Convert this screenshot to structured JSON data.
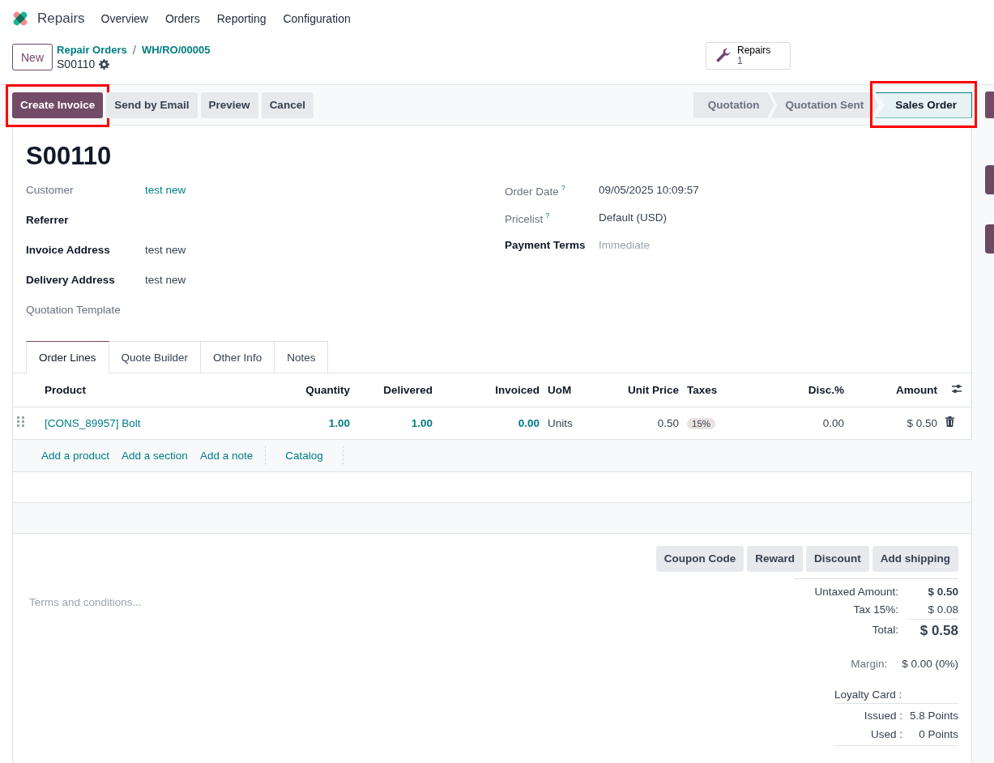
{
  "app": {
    "name": "Repairs",
    "menu": [
      "Overview",
      "Orders",
      "Reporting",
      "Configuration"
    ]
  },
  "control_panel": {
    "new_button": "New",
    "breadcrumbs": [
      "Repair Orders",
      "WH/RO/00005"
    ],
    "breadcrumb_separator": "/",
    "record": "S00110",
    "smart_button": {
      "label": "Repairs",
      "count": "1"
    }
  },
  "actions": [
    {
      "label": "Create Invoice",
      "kind": "primary",
      "highlighted": true
    },
    {
      "label": "Send by Email",
      "kind": "secondary",
      "highlighted": false
    },
    {
      "label": "Preview",
      "kind": "secondary",
      "highlighted": false
    },
    {
      "label": "Cancel",
      "kind": "secondary",
      "highlighted": false
    }
  ],
  "stages": [
    {
      "label": "Quotation",
      "selected": false,
      "highlighted": false
    },
    {
      "label": "Quotation Sent",
      "selected": false,
      "highlighted": false
    },
    {
      "label": "Sales Order",
      "selected": true,
      "highlighted": true
    }
  ],
  "title": "S00110",
  "fields_left": [
    {
      "label": "Customer",
      "bold": false,
      "value": "test new",
      "kind": "link"
    },
    {
      "label": "Referrer",
      "bold": true
    },
    {
      "label": "Invoice Address",
      "bold": true,
      "value": "test new",
      "kind": "text"
    },
    {
      "label": "Delivery Address",
      "bold": true,
      "value": "test new",
      "kind": "text"
    },
    {
      "label": "Quotation Template",
      "bold": false
    }
  ],
  "fields_right": [
    {
      "label": "Order Date",
      "bold": false,
      "help": "?",
      "value": "09/05/2025 10:09:57",
      "kind": "text"
    },
    {
      "label": "Pricelist",
      "bold": false,
      "help": "?",
      "value": "Default (USD)",
      "kind": "text"
    },
    {
      "label": "Payment Terms",
      "bold": true,
      "placeholder": "Immediate"
    }
  ],
  "tabs": [
    {
      "label": "Order Lines",
      "selected": true
    },
    {
      "label": "Quote Builder",
      "selected": false
    },
    {
      "label": "Other Info",
      "selected": false
    },
    {
      "label": "Notes",
      "selected": false
    }
  ],
  "table": {
    "columns": [
      {
        "label": "Product",
        "kind": "link",
        "numeric": false
      },
      {
        "label": "Quantity",
        "kind": "num-link",
        "numeric": true
      },
      {
        "label": "Delivered",
        "kind": "num-link",
        "numeric": true
      },
      {
        "label": "Invoiced",
        "kind": "num-link",
        "numeric": true
      },
      {
        "label": "UoM",
        "kind": "text",
        "numeric": false
      },
      {
        "label": "Unit Price",
        "kind": "text",
        "numeric": true
      },
      {
        "label": "Taxes",
        "kind": "tag",
        "numeric": false
      },
      {
        "label": "Disc.%",
        "kind": "text",
        "numeric": true
      },
      {
        "label": "Amount",
        "kind": "text",
        "numeric": true
      }
    ],
    "rows": [
      {
        "cells": [
          "[CONS_89957] Bolt",
          "1.00",
          "1.00",
          "0.00",
          "Units",
          "0.50",
          "15%",
          "0.00",
          "$ 0.50"
        ]
      }
    ],
    "add_links": [
      {
        "label": "Add a product",
        "kind": "link"
      },
      {
        "label": "Add a section",
        "kind": "link"
      },
      {
        "label": "Add a note",
        "kind": "link"
      },
      {
        "label": "Catalog",
        "kind": "button"
      }
    ]
  },
  "terms": {
    "placeholder": "Terms and conditions..."
  },
  "promo_buttons": [
    "Coupon Code",
    "Reward",
    "Discount",
    "Add shipping"
  ],
  "totals": [
    {
      "label": "Untaxed Amount:",
      "value": "$ 0.50",
      "kind": "strong"
    },
    {
      "label": "Tax 15%:",
      "value": "$ 0.08",
      "kind": "plain"
    },
    {
      "label": "Total:",
      "value": "$ 0.58",
      "kind": "total"
    }
  ],
  "margin": {
    "label": "Margin:",
    "value": "$ 0.00 (0%)"
  },
  "loyalty": {
    "title": "Loyalty Card :",
    "lines": [
      {
        "label": "Issued :",
        "value": "5.8 Points"
      },
      {
        "label": "Used :",
        "value": "0 Points"
      }
    ]
  }
}
